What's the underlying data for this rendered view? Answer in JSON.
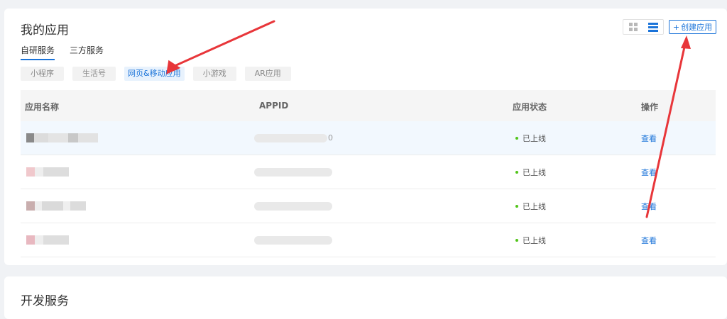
{
  "my_apps": {
    "title": "我的应用",
    "create_button": "创建应用",
    "create_plus": "+",
    "tabs": [
      {
        "label": "自研服务",
        "active": true
      },
      {
        "label": "三方服务",
        "active": false
      }
    ],
    "categories": [
      {
        "label": "小程序",
        "active": false
      },
      {
        "label": "生活号",
        "active": false
      },
      {
        "label": "网页&移动应用",
        "active": true
      },
      {
        "label": "小游戏",
        "active": false
      },
      {
        "label": "AR应用",
        "active": false
      }
    ],
    "table": {
      "headers": {
        "name": "应用名称",
        "appid": "APPID",
        "status": "应用状态",
        "action": "操作"
      },
      "rows": [
        {
          "appid_suffix": "0",
          "status": "已上线",
          "action": "查看"
        },
        {
          "appid_suffix": "",
          "status": "已上线",
          "action": "查看"
        },
        {
          "appid_suffix": "",
          "status": "已上线",
          "action": "查看"
        },
        {
          "appid_suffix": "",
          "status": "已上线",
          "action": "查看"
        }
      ]
    }
  },
  "dev_services": {
    "title": "开发服务"
  },
  "colors": {
    "accent": "#1a73d9",
    "online_dot": "#52c41a",
    "annotation_arrow": "#e8363a"
  },
  "icons": [
    "grid-view-icon",
    "list-view-icon",
    "plus-icon",
    "status-dot-icon"
  ]
}
